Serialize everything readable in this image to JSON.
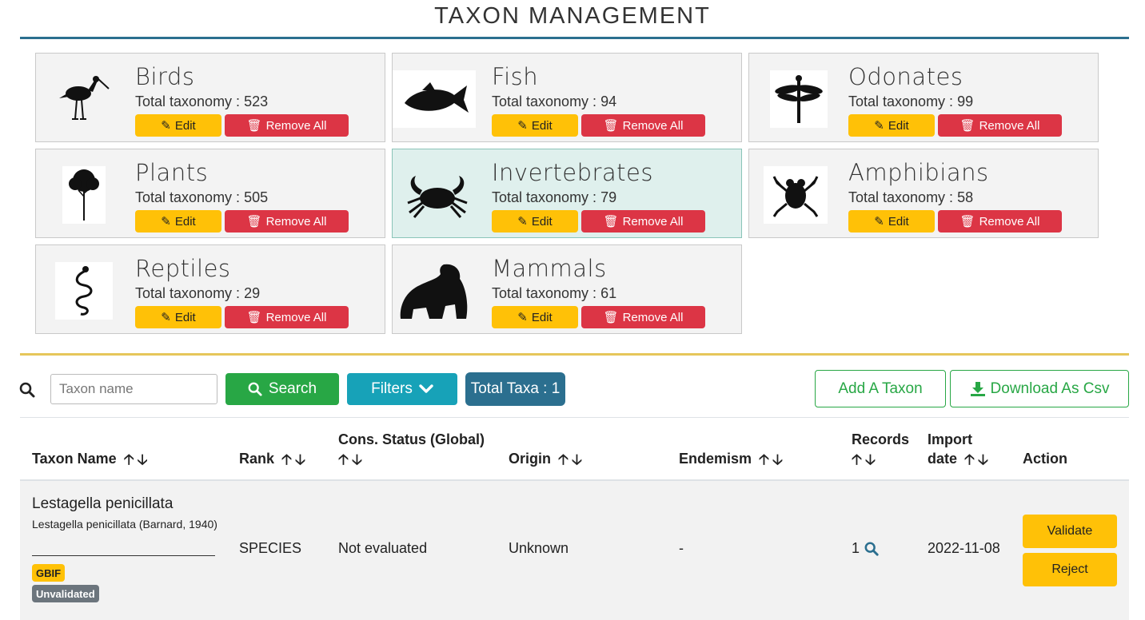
{
  "page": {
    "title": "TAXON MANAGEMENT"
  },
  "modules": [
    {
      "name": "Birds",
      "total_label": "Total taxonomy : 523",
      "edit_label": "Edit",
      "remove_label": "Remove All",
      "icon": "bird-silhouette-icon",
      "active": false
    },
    {
      "name": "Fish",
      "total_label": "Total taxonomy : 94",
      "edit_label": "Edit",
      "remove_label": "Remove All",
      "icon": "fish-silhouette-icon",
      "active": false
    },
    {
      "name": "Odonates",
      "total_label": "Total taxonomy : 99",
      "edit_label": "Edit",
      "remove_label": "Remove All",
      "icon": "dragonfly-silhouette-icon",
      "active": false
    },
    {
      "name": "Plants",
      "total_label": "Total taxonomy : 505",
      "edit_label": "Edit",
      "remove_label": "Remove All",
      "icon": "tree-silhouette-icon",
      "active": false
    },
    {
      "name": "Invertebrates",
      "total_label": "Total taxonomy : 79",
      "edit_label": "Edit",
      "remove_label": "Remove All",
      "icon": "crab-silhouette-icon",
      "active": true
    },
    {
      "name": "Amphibians",
      "total_label": "Total taxonomy : 58",
      "edit_label": "Edit",
      "remove_label": "Remove All",
      "icon": "frog-silhouette-icon",
      "active": false
    },
    {
      "name": "Reptiles",
      "total_label": "Total taxonomy : 29",
      "edit_label": "Edit",
      "remove_label": "Remove All",
      "icon": "snake-silhouette-icon",
      "active": false
    },
    {
      "name": "Mammals",
      "total_label": "Total taxonomy : 61",
      "edit_label": "Edit",
      "remove_label": "Remove All",
      "icon": "gorilla-silhouette-icon",
      "active": false
    }
  ],
  "toolbar": {
    "search_placeholder": "Taxon name",
    "search_label": "Search",
    "filters_label": "Filters",
    "total_taxa_label": "Total Taxa : 1",
    "add_label": "Add A Taxon",
    "download_label": "Download As Csv"
  },
  "table": {
    "headers": {
      "taxon_name": "Taxon Name",
      "rank": "Rank",
      "cons_status": "Cons. Status (Global)",
      "origin": "Origin",
      "endemism": "Endemism",
      "records": "Records",
      "import_date_1": "Import",
      "import_date_2": "date",
      "action": "Action"
    },
    "rows": [
      {
        "taxon_name": "Lestagella penicillata",
        "author": "Lestagella penicillata (Barnard, 1940)",
        "badge_source": "GBIF",
        "badge_status": "Unvalidated",
        "rank": "SPECIES",
        "cons_status": "Not evaluated",
        "origin": "Unknown",
        "endemism": "-",
        "records": "1",
        "import_date": "2022-11-08",
        "validate_label": "Validate",
        "reject_label": "Reject"
      }
    ]
  },
  "colors": {
    "accent": "#2b6f8f",
    "warning": "#ffc107",
    "danger": "#dc3545",
    "success": "#28a745",
    "info": "#17a2b8",
    "active_card": "#dff0ed",
    "section_rule": "#e6c65a"
  }
}
